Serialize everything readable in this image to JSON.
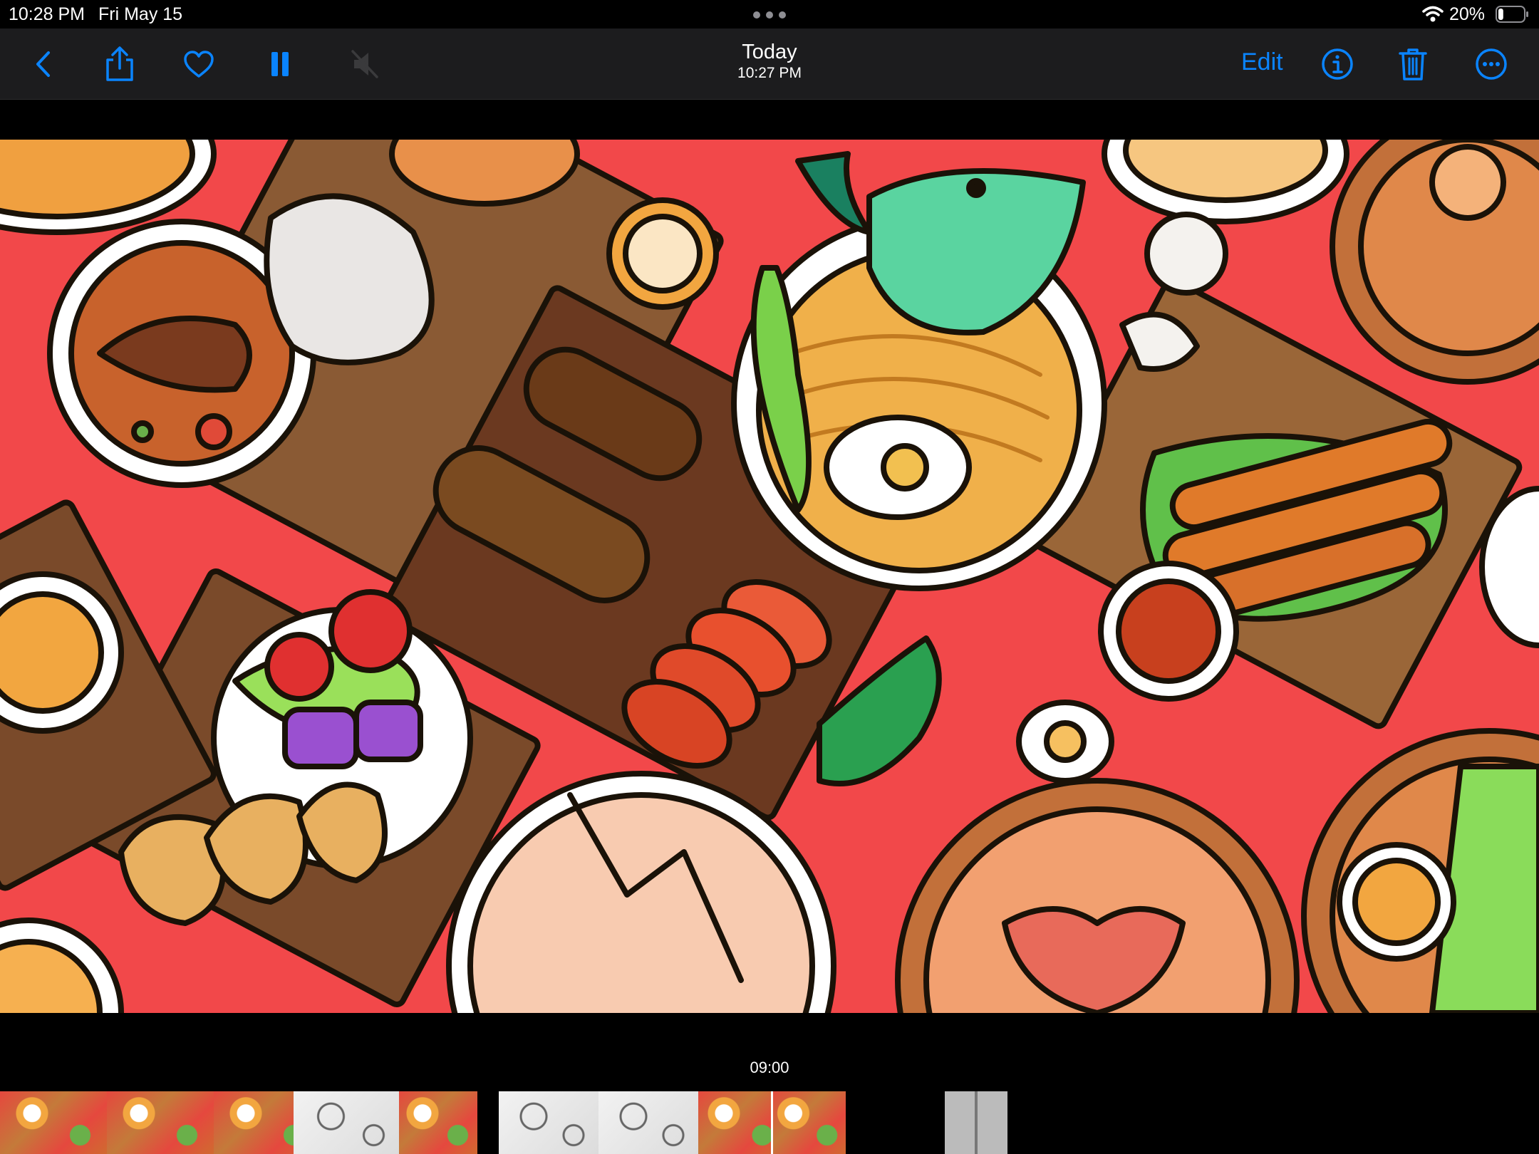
{
  "status_bar": {
    "time": "10:28 PM",
    "date": "Fri May 15",
    "battery_percent": "20%",
    "battery_level": 0.2,
    "icons": [
      "multitasking-dots-icon",
      "wifi-icon",
      "battery-icon"
    ]
  },
  "toolbar": {
    "title": "Today",
    "subtitle": "10:27 PM",
    "edit_label": "Edit",
    "accent_color": "#0a84ff",
    "left_buttons": [
      "back-chevron-icon",
      "share-icon",
      "heart-icon",
      "pause-icon",
      "speaker-muted-icon"
    ],
    "right_buttons": [
      "info-icon",
      "trash-icon",
      "more-icon"
    ]
  },
  "media": {
    "subject": "food-illustration",
    "background_color": "#f2484a"
  },
  "scrubber": {
    "time": "09:00",
    "frame_styles": [
      "color",
      "color",
      "color",
      "lineart",
      "color",
      "lineart",
      "lineart",
      "color",
      "color",
      "sketch"
    ]
  }
}
